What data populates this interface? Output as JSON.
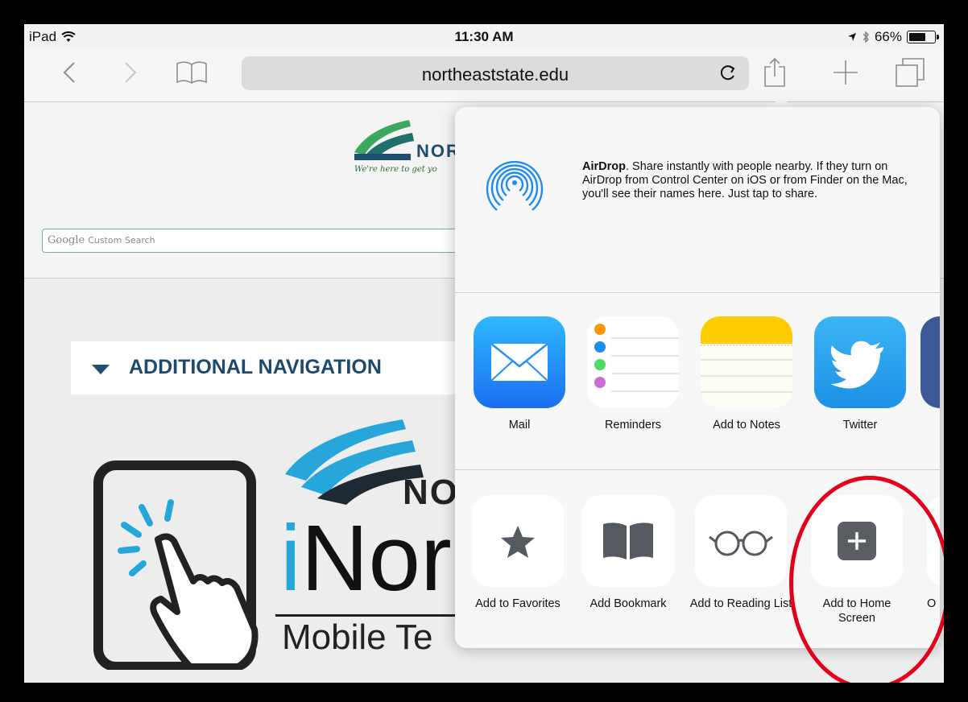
{
  "status_bar": {
    "device": "iPad",
    "time": "11:30 AM",
    "battery": "66%",
    "battery_level": 0.66
  },
  "browser": {
    "url": "northeaststate.edu"
  },
  "webpage": {
    "logo_text_partial": "NOR",
    "tagline": "We're here to get yo",
    "search_google": "Google",
    "search_custom": "Custom Search",
    "additional_navigation": "ADDITIONAL NAVIGATION",
    "inor_partial_top": "NO",
    "inor_partial_big": "iNor",
    "mobile_text": "Mobile Te"
  },
  "share_sheet": {
    "airdrop_title": "AirDrop",
    "airdrop_text": ". Share instantly with people nearby. If they turn on AirDrop from Control Center on iOS or from Finder on the Mac, you'll see their names here. Just tap to share.",
    "share_apps": [
      {
        "label": "Mail",
        "icon": "mail-icon"
      },
      {
        "label": "Reminders",
        "icon": "reminders-icon"
      },
      {
        "label": "Add to Notes",
        "icon": "notes-icon"
      },
      {
        "label": "Twitter",
        "icon": "twitter-icon"
      }
    ],
    "actions": [
      {
        "label": "Add to Favorites",
        "icon": "star-icon"
      },
      {
        "label": "Add Bookmark",
        "icon": "book-icon"
      },
      {
        "label": "Add to Reading List",
        "icon": "glasses-icon"
      },
      {
        "label": "Add to Home Screen",
        "icon": "plus-square-icon"
      },
      {
        "label": "O",
        "icon": "partial-icon"
      }
    ]
  },
  "colors": {
    "annotation": "#e3001b",
    "accent_blue": "#1c4a6e"
  }
}
